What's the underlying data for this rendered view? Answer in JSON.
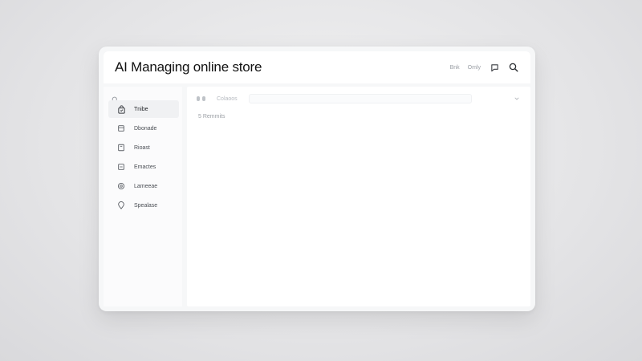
{
  "header": {
    "title": "AI Managing online store",
    "links": [
      "Bnk",
      "Omly"
    ]
  },
  "sidebar": {
    "items": [
      {
        "label": "Tnibe",
        "icon": "bag-icon",
        "active": true
      },
      {
        "label": "Dbonade",
        "icon": "database-icon",
        "active": false
      },
      {
        "label": "Rioast",
        "icon": "document-icon",
        "active": false
      },
      {
        "label": "Emactes",
        "icon": "minus-box-icon",
        "active": false
      },
      {
        "label": "Lameeae",
        "icon": "gear-icon",
        "active": false
      },
      {
        "label": "Spealase",
        "icon": "pin-icon",
        "active": false
      }
    ]
  },
  "main": {
    "toolbar_label": "Colaoos",
    "result_count": "5 Remmits"
  }
}
